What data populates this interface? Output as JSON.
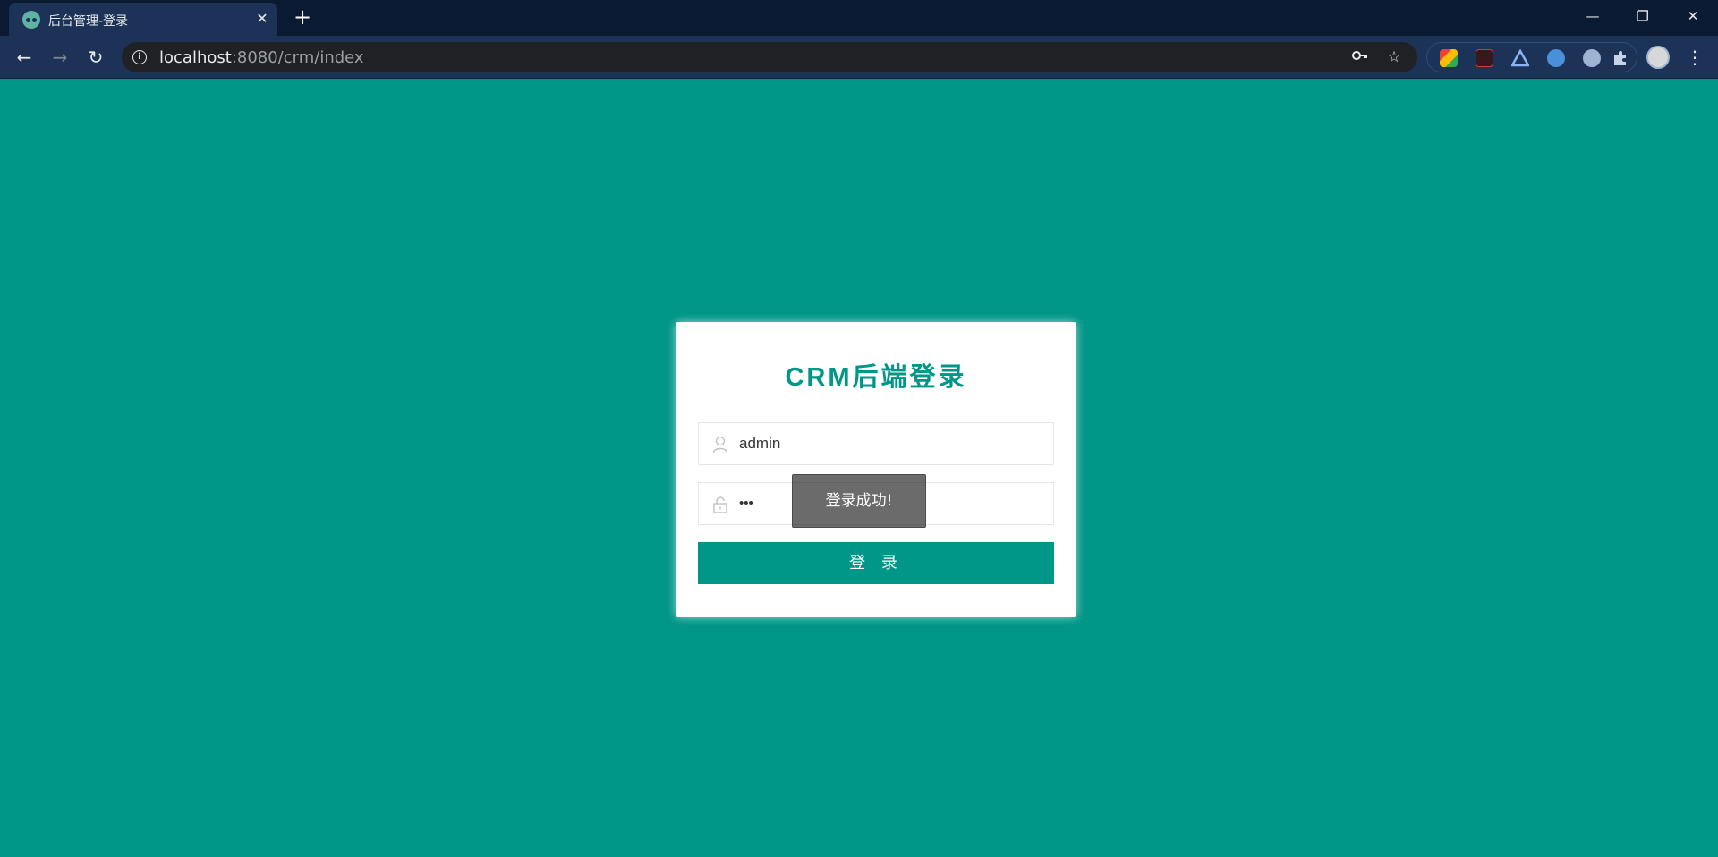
{
  "browser": {
    "tab_title": "后台管理-登录",
    "tab_close": "✕",
    "new_tab": "+",
    "url_host": "localhost",
    "url_rest": ":8080/crm/index",
    "window_controls": {
      "minimize": "—",
      "restore": "❐",
      "close": "✕"
    },
    "nav": {
      "back": "←",
      "forward": "→",
      "reload": "↻"
    },
    "omnibox_icons": {
      "key": "key-icon",
      "star": "☆"
    },
    "menu": "⋮"
  },
  "login": {
    "title": "CRM后端登录",
    "username_value": "admin",
    "password_value": "•••",
    "button_label": "登 录"
  },
  "toast": {
    "message": "登录成功!"
  },
  "colors": {
    "page_background": "#009688",
    "accent": "#009688",
    "browser_chrome": "#1c3357"
  }
}
